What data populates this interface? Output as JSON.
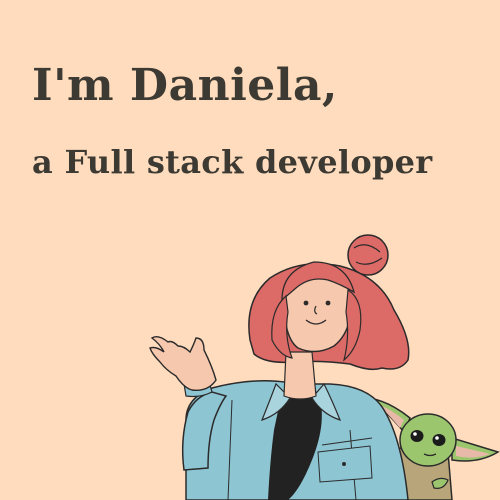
{
  "hero": {
    "headline": "I'm Daniela,",
    "subheadline": "a Full stack developer"
  },
  "illustration": {
    "person": "woman-with-red-hair-bun-waving",
    "companion": "baby-yoda-character"
  },
  "colors": {
    "background": "#ffdcbd",
    "text": "#3d3a33",
    "hair": "#dc6a66",
    "skin": "#f6c8ae",
    "jacket": "#8ec5d3",
    "shirt": "#222222",
    "companion_skin": "#9cc66e"
  }
}
